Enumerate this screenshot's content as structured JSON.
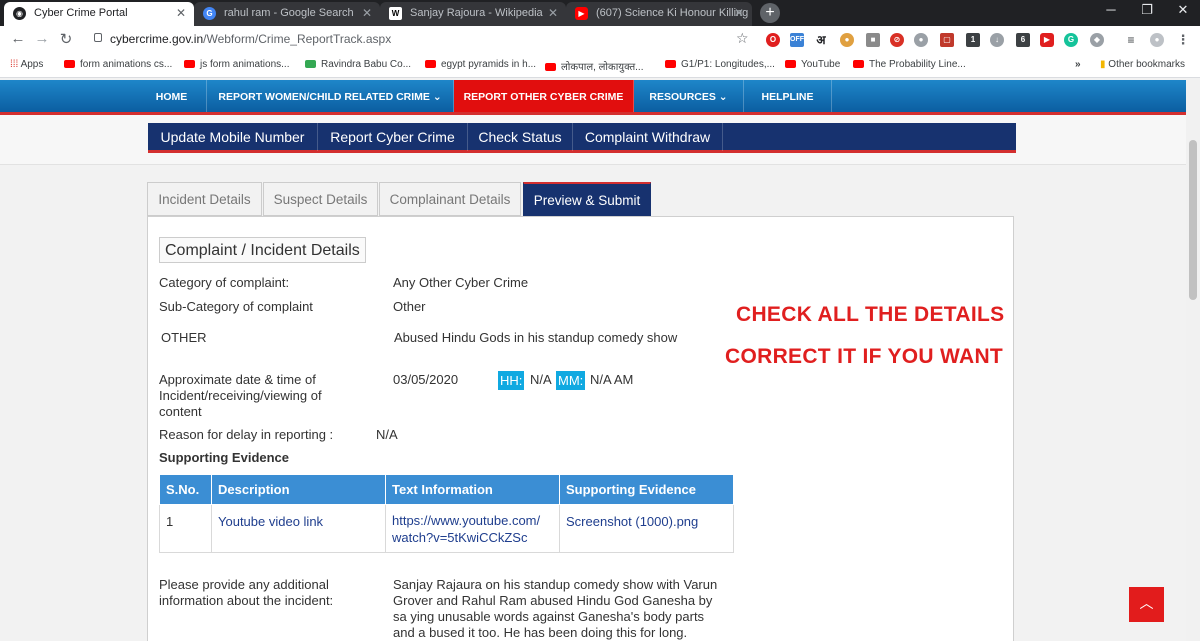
{
  "browser": {
    "tabs": [
      {
        "title": "Cyber Crime Portal",
        "active": true
      },
      {
        "title": "rahul ram - Google Search",
        "active": false
      },
      {
        "title": "Sanjay Rajoura - Wikipedia",
        "active": false
      },
      {
        "title": "(607) Science Ki Honour Killing ||",
        "active": false
      }
    ],
    "url_host": "cybercrime.gov.in",
    "url_path": "/Webform/Crime_ReportTrack.aspx",
    "bookmarks": [
      "Apps",
      "form animations cs...",
      "js form animations...",
      "Ravindra Babu Co...",
      "egypt pyramids in h...",
      "लोकपाल, लोकायुक्त...",
      "G1/P1: Longitudes,...",
      "YouTube",
      "The Probability Line...",
      "»",
      "Other bookmarks"
    ],
    "ext_badge_off": "OFF",
    "ext_hindi": "अ",
    "ext_badge_1": "1",
    "ext_badge_6": "6"
  },
  "nav": {
    "items": [
      "HOME",
      "REPORT WOMEN/CHILD RELATED CRIME ⌄",
      "REPORT OTHER CYBER CRIME",
      "RESOURCES ⌄",
      "HELPLINE"
    ],
    "active_index": 2
  },
  "subnav": {
    "items": [
      "Update Mobile Number",
      "Report Cyber Crime",
      "Check Status",
      "Complaint Withdraw"
    ]
  },
  "form_tabs": {
    "items": [
      "Incident Details",
      "Suspect Details",
      "Complainant Details",
      "Preview & Submit"
    ],
    "active_index": 3
  },
  "details": {
    "section_title": "Complaint / Incident Details",
    "category_label": "Category of complaint:",
    "category_value": "Any Other Cyber Crime",
    "subcategory_label": "Sub-Category of complaint",
    "subcategory_value": "Other",
    "other_label": "OTHER",
    "other_value": "Abused Hindu Gods in his standup comedy show",
    "date_label": "Approximate date & time of Incident/receiving/viewing of content",
    "date_value": "03/05/2020",
    "hh_label": "HH:",
    "hh_value": "N/A",
    "mm_label": "MM:",
    "mm_value": "N/A AM",
    "delay_label": "Reason for delay in reporting :",
    "delay_value": "N/A",
    "evidence_heading": "Supporting Evidence",
    "additional_label": "Please provide any additional information about the incident:",
    "additional_value": "Sanjay Rajaura on his standup comedy show with Varun Grover and Rahul Ram abused Hindu God Ganesha by sa ying unusable words against Ganesha's body parts and a bused it too. He has been doing this for long."
  },
  "evidence_table": {
    "headers": [
      "S.No.",
      "Description",
      "Text Information",
      "Supporting Evidence"
    ],
    "rows": [
      [
        "1",
        "Youtube video link",
        "https://www.youtube.com/ watch?v=5tKwiCCkZSc",
        "Screenshot (1000).png"
      ]
    ]
  },
  "callouts": {
    "line1": "CHECK ALL THE DETAILS",
    "line2": "CORRECT IT IF YOU WANT"
  },
  "colors": {
    "nav_blue": "#1e86c9",
    "nav_active_red": "#e10e0e",
    "subnav_navy": "#17326f",
    "table_header_blue": "#3b8ed4",
    "chip_cyan": "#10a9e1",
    "callout_red": "#e01f1f"
  }
}
